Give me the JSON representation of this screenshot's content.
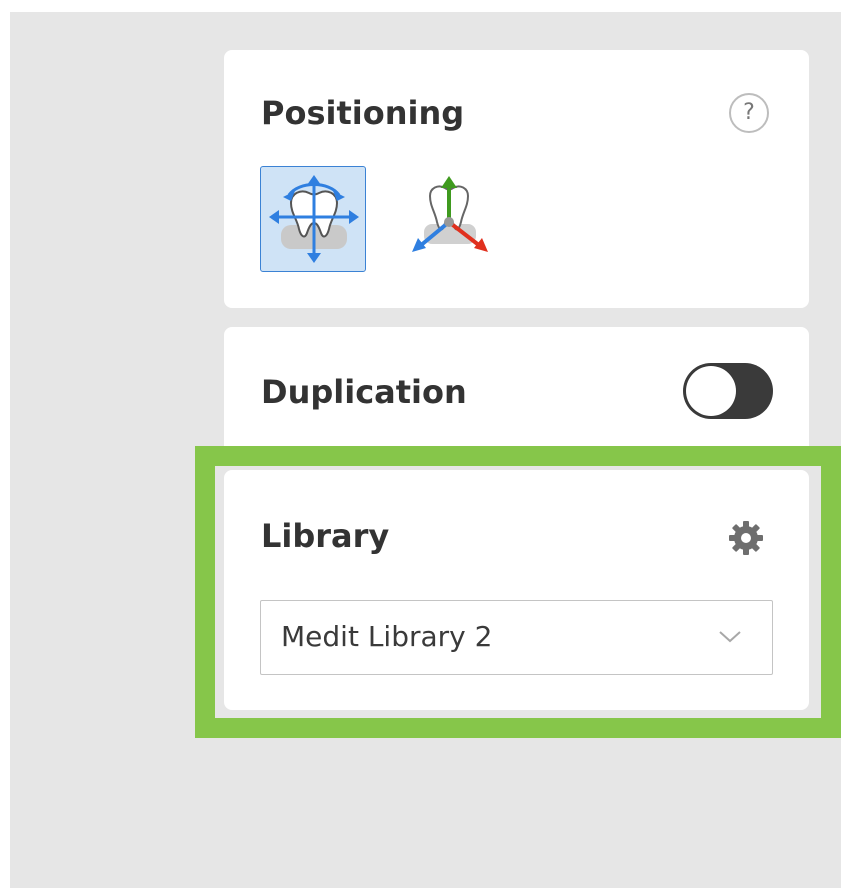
{
  "positioning": {
    "title": "Positioning",
    "help_label": "?",
    "tools": [
      {
        "icon": "move-rotate-icon",
        "active": true
      },
      {
        "icon": "axis-gizmo-icon",
        "active": false
      }
    ]
  },
  "duplication": {
    "title": "Duplication",
    "toggle_on": false
  },
  "library": {
    "title": "Library",
    "settings_icon": "gear-icon",
    "selected": "Medit Library 2"
  },
  "colors": {
    "highlight": "#86c64a",
    "active_tool_bg": "#cfe3f6",
    "active_tool_border": "#3b82d4",
    "arrow_blue": "#2f7fe0",
    "arrow_green": "#3f9a1f",
    "arrow_red": "#e0301e"
  }
}
